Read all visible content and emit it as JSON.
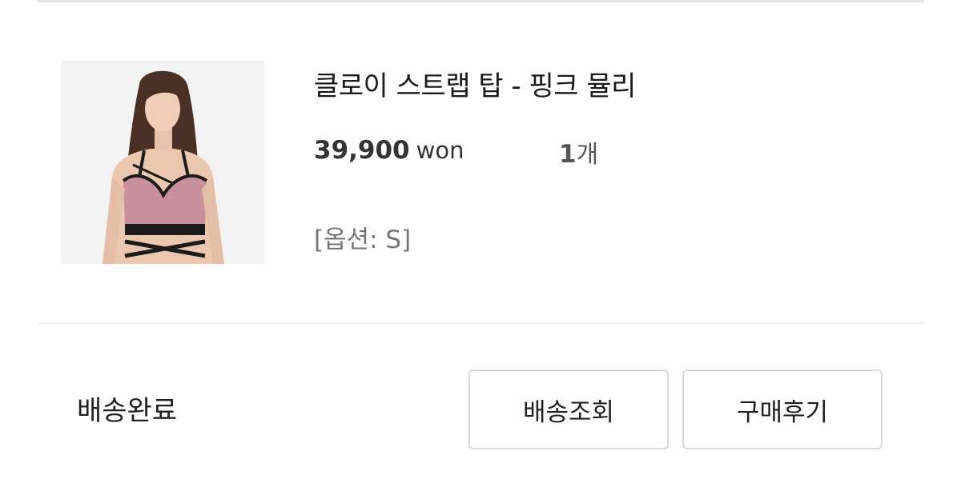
{
  "product": {
    "title": "클로이 스트랩 탑 - 핑크 뮬리",
    "price_amount": "39,900",
    "price_unit": "won",
    "quantity": "1",
    "quantity_unit": "개",
    "option": "[옵션: S]",
    "image_icon": "product-photo-sports-bra"
  },
  "order": {
    "status": "배송완료",
    "track_button": "배송조회",
    "review_button": "구매후기"
  },
  "colors": {
    "garment": "#c98f9c",
    "trim": "#1c1c1c",
    "border": "#d9d9d9"
  }
}
